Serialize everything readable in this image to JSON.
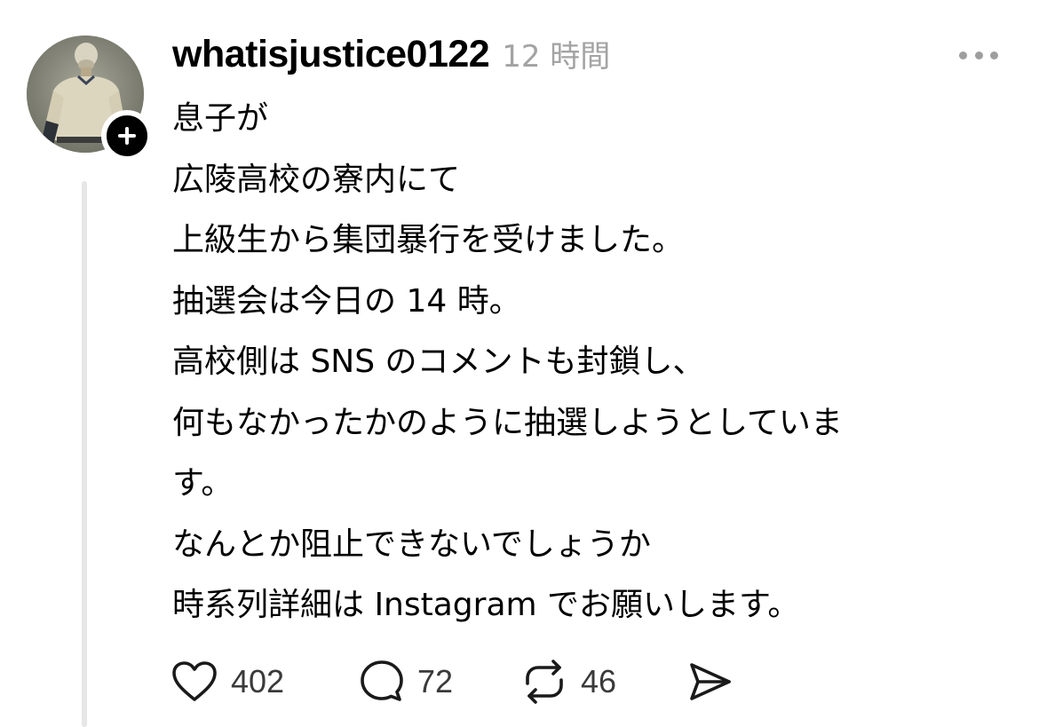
{
  "post": {
    "username": "whatisjustice0122",
    "time": "12 時間",
    "avatar_icon": "baseball-player-avatar",
    "follow_icon": "plus-icon",
    "more_icon": "more-dots-icon",
    "body_lines": [
      "息子が",
      "広陵高校の寮内にて",
      "上級生から集団暴行を受けました。",
      "抽選会は今日の 14 時。",
      "高校側は SNS のコメントも封鎖し、",
      "何もなかったかのように抽選しようとしていま",
      "す。",
      "なんとか阻止できないでしょうか",
      "時系列詳細は Instagram でお願いします。"
    ]
  },
  "actions": {
    "like": {
      "icon": "heart-icon",
      "count": "402"
    },
    "reply": {
      "icon": "comment-bubble-icon",
      "count": "72"
    },
    "repost": {
      "icon": "repost-icon",
      "count": "46"
    },
    "share": {
      "icon": "send-icon"
    }
  },
  "colors": {
    "text": "#000000",
    "muted": "#a3a3a3",
    "thread_line": "#e6e6e6",
    "icon": "#1a1a1a"
  }
}
